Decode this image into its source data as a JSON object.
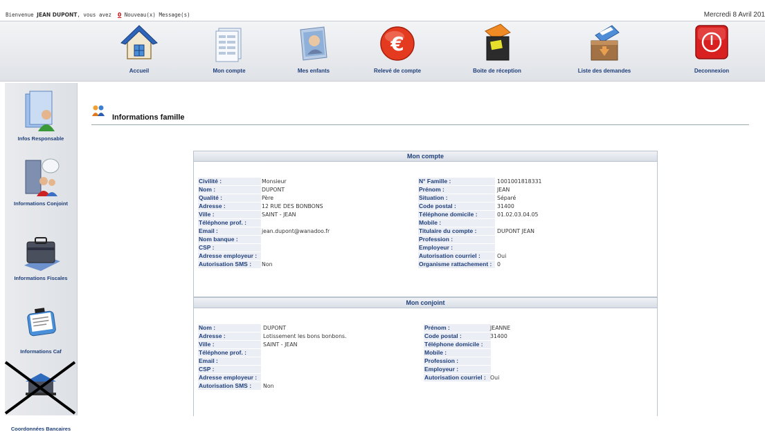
{
  "welcome": {
    "prefix": "Bienvenue ",
    "user": "JEAN DUPONT",
    "middle": ", vous avez ",
    "count": "0",
    "suffix": " Nouveau(x) Message(s)",
    "date": "Mercredi 8 Avril 201"
  },
  "topnav": [
    {
      "label": "Accueil",
      "icon": "house-icon"
    },
    {
      "label": "Mon compte",
      "icon": "account-document-icon"
    },
    {
      "label": "Mes enfants",
      "icon": "children-photo-icon"
    },
    {
      "label": "Relevé de compte",
      "icon": "euro-icon"
    },
    {
      "label": "Boite de réception",
      "icon": "inbox-icon"
    },
    {
      "label": "Liste des demandes",
      "icon": "requests-box-icon"
    },
    {
      "label": "Deconnexion",
      "icon": "power-icon"
    }
  ],
  "sidebar": [
    {
      "label": "Infos Responsable",
      "icon": "responsible-person-icon"
    },
    {
      "label": "Informations Conjoint",
      "icon": "spouse-icon"
    },
    {
      "label": "Informations Fiscales",
      "icon": "briefcase-icon"
    },
    {
      "label": "Informations Caf",
      "icon": "clipboard-icon"
    },
    {
      "label": "Coordonnées Bancaires",
      "icon": "bank-icon"
    }
  ],
  "page_title": "Informations famille",
  "mon_compte": {
    "title": "Mon compte",
    "left": [
      {
        "k": "Civilité :",
        "v": "Monsieur"
      },
      {
        "k": "Nom :",
        "v": "DUPONT"
      },
      {
        "k": "Qualité :",
        "v": "Père"
      },
      {
        "k": "Adresse :",
        "v": "12 RUE DES BONBONS"
      },
      {
        "k": "Ville :",
        "v": "SAINT - JEAN"
      },
      {
        "k": "Téléphone prof. :",
        "v": ""
      },
      {
        "k": "Email :",
        "v": "jean.dupont@wanadoo.fr"
      },
      {
        "k": "Nom banque :",
        "v": ""
      },
      {
        "k": "CSP :",
        "v": ""
      },
      {
        "k": "Adresse employeur :",
        "v": ""
      },
      {
        "k": "Autorisation SMS :",
        "v": "Non"
      }
    ],
    "right": [
      {
        "k": "N° Famille :",
        "v": "1001001818331"
      },
      {
        "k": "Prénom :",
        "v": "JEAN"
      },
      {
        "k": "Situation :",
        "v": "Séparé"
      },
      {
        "k": "Code postal :",
        "v": "31400"
      },
      {
        "k": "Téléphone domicile :",
        "v": "01.02.03.04.05"
      },
      {
        "k": "Mobile :",
        "v": ""
      },
      {
        "k": "Titulaire du compte :",
        "v": "DUPONT JEAN"
      },
      {
        "k": "Profession :",
        "v": ""
      },
      {
        "k": "Employeur :",
        "v": ""
      },
      {
        "k": "Autorisation courriel :",
        "v": "Oui"
      },
      {
        "k": "Organisme rattachement :",
        "v": "0"
      }
    ]
  },
  "mon_conjoint": {
    "title": "Mon conjoint",
    "left": [
      {
        "k": "Nom :",
        "v": "DUPONT"
      },
      {
        "k": "Adresse :",
        "v": "Lotissement les bons bonbons."
      },
      {
        "k": "Ville :",
        "v": "SAINT - JEAN"
      },
      {
        "k": "Téléphone prof. :",
        "v": ""
      },
      {
        "k": "Email :",
        "v": ""
      },
      {
        "k": "CSP :",
        "v": ""
      },
      {
        "k": "Adresse employeur :",
        "v": ""
      },
      {
        "k": "Autorisation SMS :",
        "v": "Non"
      }
    ],
    "right": [
      {
        "k": "Prénom :",
        "v": "JEANNE"
      },
      {
        "k": "Code postal :",
        "v": "31400"
      },
      {
        "k": "Téléphone domicile :",
        "v": ""
      },
      {
        "k": "Mobile :",
        "v": ""
      },
      {
        "k": "Profession :",
        "v": ""
      },
      {
        "k": "Employeur :",
        "v": ""
      },
      {
        "k": "Autorisation courriel :",
        "v": "Oui"
      }
    ]
  }
}
